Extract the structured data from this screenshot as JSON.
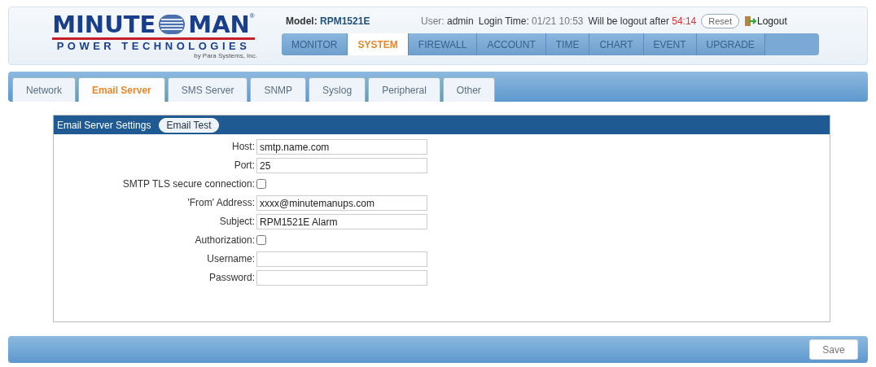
{
  "logo": {
    "word_left": "MINUTE",
    "word_right": "MAN",
    "mark": "®",
    "tagline": "POWER TECHNOLOGIES",
    "subline": "by Para Systems, Inc."
  },
  "model": {
    "label": "Model:",
    "value": "RPM1521E"
  },
  "session": {
    "user_label": "User:",
    "user": "admin",
    "login_label": "Login Time:",
    "login_time": "01/21 10:53",
    "logout_label": "Will be logout after",
    "countdown": "54:14"
  },
  "reset_button": "Reset",
  "logout_link": "Logout",
  "nav": [
    {
      "label": "MONITOR",
      "selected": false
    },
    {
      "label": "SYSTEM",
      "selected": true
    },
    {
      "label": "FIREWALL",
      "selected": false
    },
    {
      "label": "ACCOUNT",
      "selected": false
    },
    {
      "label": "TIME",
      "selected": false
    },
    {
      "label": "CHART",
      "selected": false
    },
    {
      "label": "EVENT",
      "selected": false
    },
    {
      "label": "UPGRADE",
      "selected": false
    }
  ],
  "tabs": [
    {
      "label": "Network",
      "selected": false
    },
    {
      "label": "Email Server",
      "selected": true
    },
    {
      "label": "SMS Server",
      "selected": false
    },
    {
      "label": "SNMP",
      "selected": false
    },
    {
      "label": "Syslog",
      "selected": false
    },
    {
      "label": "Peripheral",
      "selected": false
    },
    {
      "label": "Other",
      "selected": false
    }
  ],
  "panel": {
    "title": "Email Server Settings",
    "test_button": "Email Test",
    "fields": [
      {
        "kind": "text",
        "label": "Host:",
        "value": "smtp.name.com"
      },
      {
        "kind": "text",
        "label": "Port:",
        "value": "25"
      },
      {
        "kind": "checkbox",
        "label": "SMTP TLS secure connection:",
        "checked": false
      },
      {
        "kind": "text",
        "label": "'From' Address:",
        "value": "xxxx@minutemanups.com"
      },
      {
        "kind": "text",
        "label": "Subject:",
        "value": "RPM1521E Alarm"
      },
      {
        "kind": "checkbox",
        "label": "Authorization:",
        "checked": false
      },
      {
        "kind": "text",
        "label": "Username:"
      },
      {
        "kind": "password",
        "label": "Password:"
      }
    ]
  },
  "save_button": "Save"
}
